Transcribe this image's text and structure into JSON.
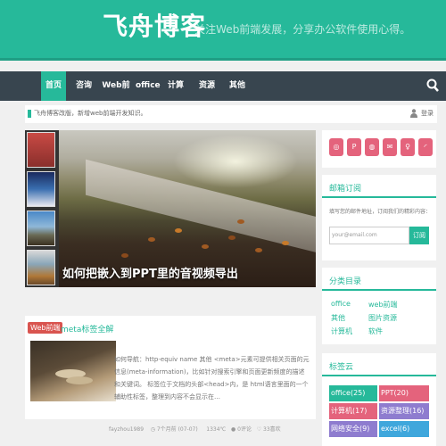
{
  "header": {
    "title": "飞舟博客",
    "tagline": "- 关注Web前端发展，分享办公软件使用心得。"
  },
  "nav": {
    "items": [
      "首页",
      "咨询",
      "Web前端",
      "office",
      "计算机",
      "资源",
      "其他"
    ],
    "active_index": 0,
    "search_icon": "search-icon"
  },
  "notice": {
    "text": "飞舟博客改版，新增web前端开发知识。",
    "login": "登录"
  },
  "slider": {
    "caption": "如何把嵌入到PPT里的音视频导出"
  },
  "article": {
    "category": "Web前端",
    "title": "meta标签全解",
    "excerpt": "如何导航：http-equiv name 其他 <meta>元素可提供相关页面的元信息(meta-information)，比如针对搜索引擎和页面更新频度的描述和关键词。 标签位于文档的头部<head>内，是 html语言里面的一个辅助性标签，整理到内容不会显示在…",
    "meta": {
      "author": "fayzhou1989",
      "time": "7个月前 (07-07)",
      "views": "1334℃",
      "comments": "0评论",
      "likes": "33喜欢"
    }
  },
  "sidebar": {
    "subscribe": {
      "title": "邮箱订阅",
      "desc": "填写您的邮件地址，订阅我们的精彩内容：",
      "placeholder": "your@email.com",
      "button": "订阅"
    },
    "categories": {
      "title": "分类目录",
      "items": [
        "office",
        "web前端",
        "其他",
        "图片资源",
        "计算机",
        "软件"
      ]
    },
    "tags": {
      "title": "标签云",
      "items": [
        "office(25)",
        "PPT(20)",
        "计算机(17)",
        "资源整理(16)",
        "网络安全(9)",
        "excel(6)"
      ]
    }
  },
  "colors": {
    "brand": "#26b99a",
    "nav_bg": "#38454f",
    "badge": "#d9544f",
    "tag_colors": [
      "#26b99a",
      "#e4637c",
      "#e4637c",
      "#8e7ccf",
      "#8e7ccf",
      "#3fa7dc"
    ]
  }
}
